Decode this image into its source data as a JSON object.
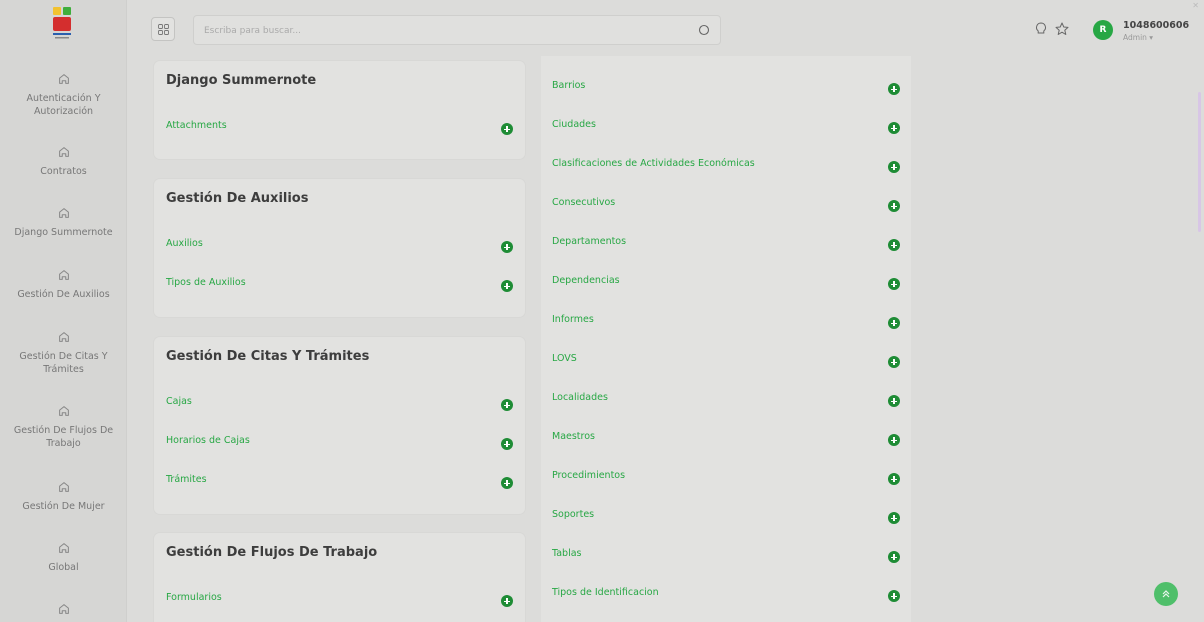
{
  "search": {
    "placeholder": "Escriba para buscar..."
  },
  "user": {
    "id": "1048600606",
    "role": "Admin ▾",
    "initial": "R"
  },
  "sidebar": {
    "items": [
      {
        "label": "Autenticación Y Autorización"
      },
      {
        "label": "Contratos"
      },
      {
        "label": "Django Summernote"
      },
      {
        "label": "Gestión De Auxilios"
      },
      {
        "label": "Gestión De Citas Y Trámites"
      },
      {
        "label": "Gestión De Flujos De Trabajo"
      },
      {
        "label": "Gestión De Mujer"
      },
      {
        "label": "Global"
      }
    ]
  },
  "cards": {
    "summernote": {
      "title": "Django Summernote",
      "links": [
        "Attachments"
      ]
    },
    "auxilios": {
      "title": "Gestión De Auxilios",
      "links": [
        "Auxilios",
        "Tipos de Auxilios"
      ]
    },
    "citas": {
      "title": "Gestión De Citas Y Trámites",
      "links": [
        "Cajas",
        "Horarios de Cajas",
        "Trámites"
      ]
    },
    "flujos": {
      "title": "Gestión De Flujos De Trabajo",
      "links": [
        "Formularios"
      ]
    }
  },
  "global_links": [
    "Barrios",
    "Ciudades",
    "Clasificaciones de Actividades Económicas",
    "Consecutivos",
    "Departamentos",
    "Dependencias",
    "Informes",
    "LOVS",
    "Localidades",
    "Maestros",
    "Procedimientos",
    "Soportes",
    "Tablas",
    "Tipos de Identificacion"
  ],
  "colors": {
    "accent": "#27a744",
    "add_button": "#1e8c35"
  }
}
